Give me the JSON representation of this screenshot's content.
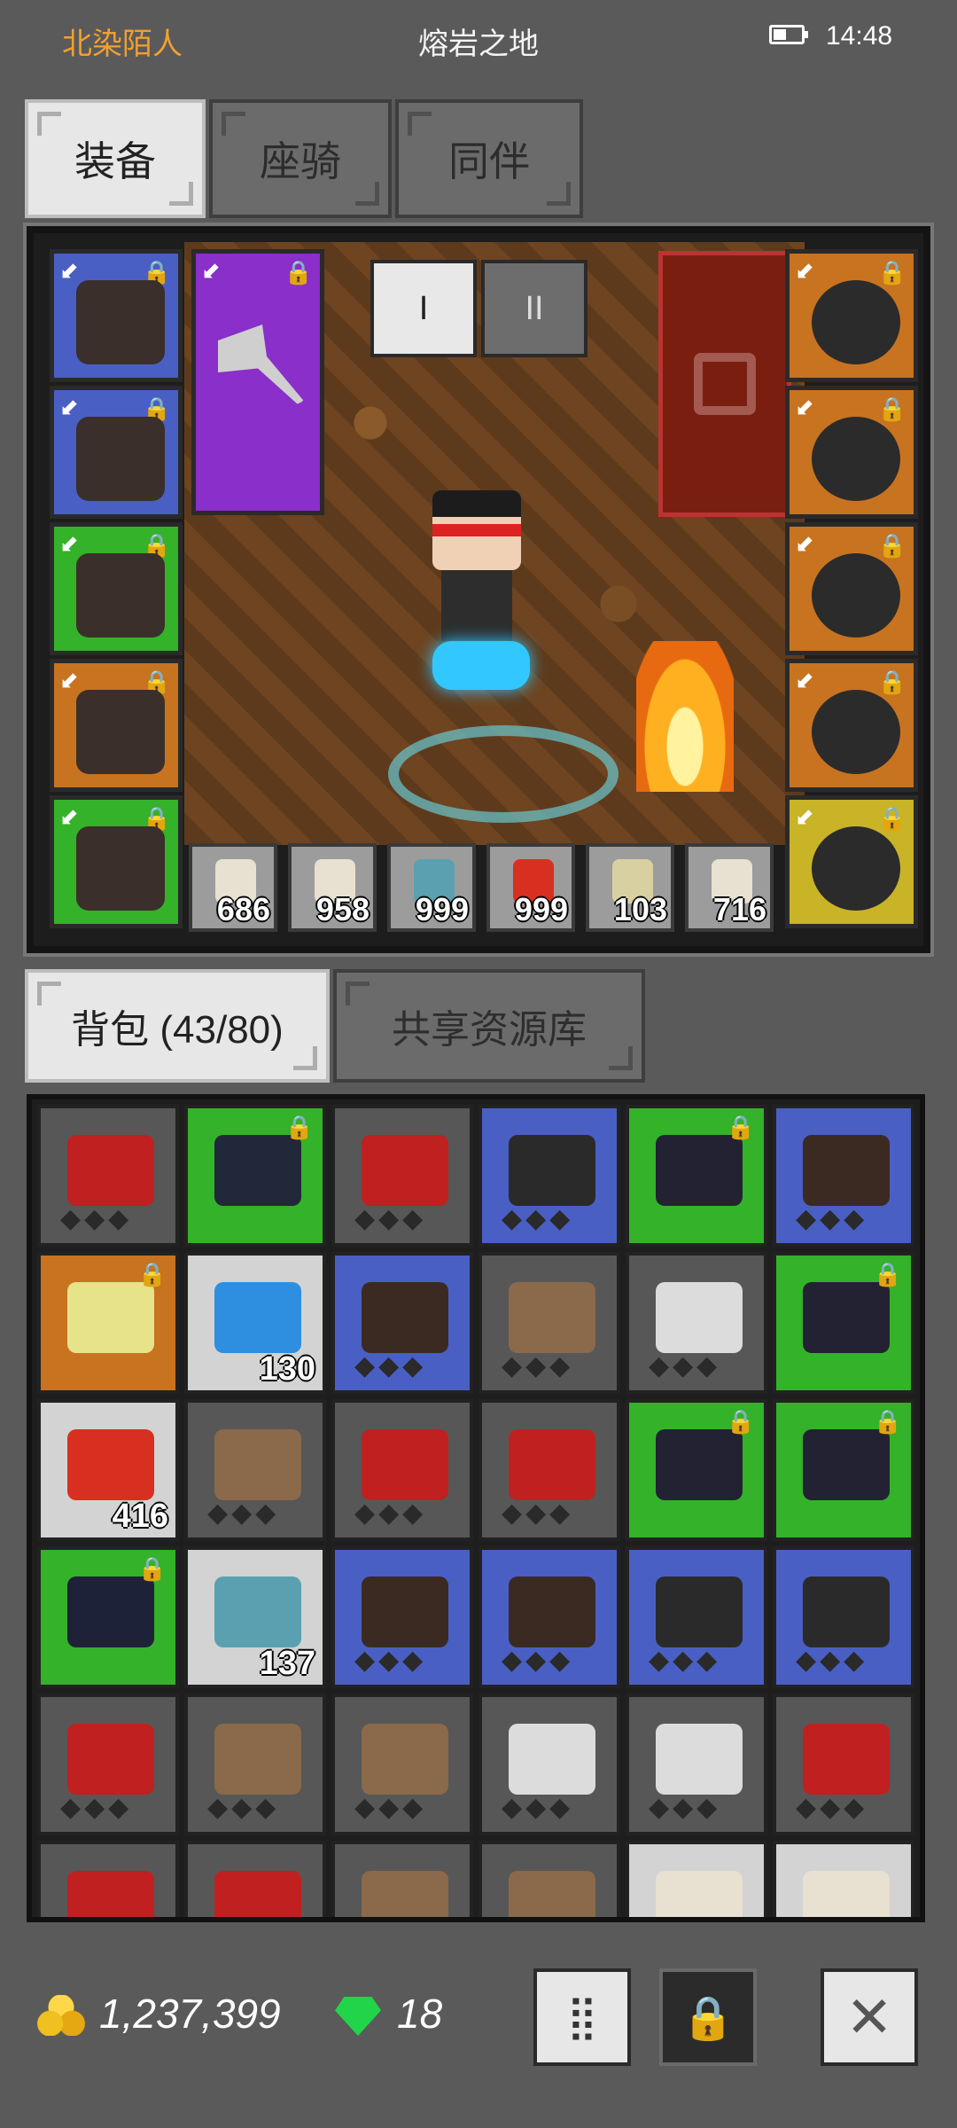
{
  "status": {
    "player": "北染陌人",
    "map": "熔岩之地",
    "time": "14:48"
  },
  "top_tabs": [
    "装备",
    "座骑",
    "同伴"
  ],
  "equip": {
    "set_buttons": [
      "I",
      "II"
    ],
    "potions": [
      {
        "qty": "686",
        "color": "#e8e0d0"
      },
      {
        "qty": "958",
        "color": "#e8e0d0"
      },
      {
        "qty": "999",
        "color": "#5aa0b0"
      },
      {
        "qty": "999",
        "color": "#d83020"
      },
      {
        "qty": "103",
        "color": "#d8d0a0"
      },
      {
        "qty": "716",
        "color": "#e8e0d0"
      }
    ],
    "left_slots": [
      {
        "color": "blue",
        "icon": "helmet-icon"
      },
      {
        "color": "blue",
        "icon": "chest-armor-icon"
      },
      {
        "color": "green",
        "icon": "gauntlet-icon"
      },
      {
        "color": "orange",
        "icon": "boots-icon"
      },
      {
        "color": "green",
        "icon": "pauldron-icon"
      }
    ],
    "right_slots": [
      {
        "color": "orange",
        "icon": "ruby-amulet-icon"
      },
      {
        "color": "orange",
        "icon": "emerald-ring-icon"
      },
      {
        "color": "orange",
        "icon": "emerald-ring-icon"
      },
      {
        "color": "orange",
        "icon": "blue-orb-icon"
      },
      {
        "color": "yellow",
        "icon": "cat-pet-icon"
      }
    ]
  },
  "bag_tabs": [
    "背包 (43/80)",
    "共享资源库"
  ],
  "bag": [
    {
      "c": "",
      "ico": "red-bow-icon",
      "col": "#c02020",
      "lock": false,
      "gem": true
    },
    {
      "c": "green",
      "ico": "helmet-icon",
      "col": "#20283a",
      "lock": true,
      "gem": false
    },
    {
      "c": "",
      "ico": "red-bow-icon",
      "col": "#c02020",
      "lock": false,
      "gem": true
    },
    {
      "c": "blue",
      "ico": "chest-armor-icon",
      "col": "#2a2a2a",
      "lock": false,
      "gem": true
    },
    {
      "c": "green",
      "ico": "mace-icon",
      "col": "#222233",
      "lock": true,
      "gem": false
    },
    {
      "c": "blue",
      "ico": "helmet-icon",
      "col": "#3a2a22",
      "lock": false,
      "gem": true
    },
    {
      "c": "orange",
      "ico": "shield-egg-icon",
      "col": "#e6e38a",
      "lock": true,
      "gem": false
    },
    {
      "c": "white",
      "ico": "blue-feather-icon",
      "col": "#2e8fe0",
      "lock": false,
      "gem": false,
      "qty": "130"
    },
    {
      "c": "blue",
      "ico": "helmet-icon",
      "col": "#3a2a22",
      "lock": false,
      "gem": true
    },
    {
      "c": "",
      "ico": "wood-bow-icon",
      "col": "#8a6a4a",
      "lock": false,
      "gem": true
    },
    {
      "c": "",
      "ico": "axe-icon",
      "col": "#dcdcdc",
      "lock": false,
      "gem": true
    },
    {
      "c": "green",
      "ico": "mace-icon",
      "col": "#222233",
      "lock": true,
      "gem": false
    },
    {
      "c": "white",
      "ico": "red-feather-icon",
      "col": "#d83020",
      "lock": false,
      "gem": false,
      "qty": "416"
    },
    {
      "c": "",
      "ico": "wood-bow-icon",
      "col": "#8a6a4a",
      "lock": false,
      "gem": true
    },
    {
      "c": "",
      "ico": "red-spear-icon",
      "col": "#c02020",
      "lock": false,
      "gem": true
    },
    {
      "c": "",
      "ico": "red-bow-icon",
      "col": "#c02020",
      "lock": false,
      "gem": true
    },
    {
      "c": "green",
      "ico": "mace-icon",
      "col": "#222233",
      "lock": true,
      "gem": false
    },
    {
      "c": "green",
      "ico": "mace-icon",
      "col": "#222233",
      "lock": true,
      "gem": false
    },
    {
      "c": "green",
      "ico": "chest-armor-icon",
      "col": "#1e2238",
      "lock": true,
      "gem": false
    },
    {
      "c": "white",
      "ico": "fish-icon",
      "col": "#5aa0b0",
      "lock": false,
      "gem": false,
      "qty": "137"
    },
    {
      "c": "blue",
      "ico": "helmet-icon",
      "col": "#3a2a22",
      "lock": false,
      "gem": true
    },
    {
      "c": "blue",
      "ico": "helmet-icon",
      "col": "#3a2a22",
      "lock": false,
      "gem": true
    },
    {
      "c": "blue",
      "ico": "chest-armor-icon",
      "col": "#2a2a2a",
      "lock": false,
      "gem": true
    },
    {
      "c": "blue",
      "ico": "chest-armor-icon",
      "col": "#2a2a2a",
      "lock": false,
      "gem": true
    },
    {
      "c": "",
      "ico": "red-bow-icon",
      "col": "#c02020",
      "lock": false,
      "gem": true
    },
    {
      "c": "",
      "ico": "wood-bow-icon",
      "col": "#8a6a4a",
      "lock": false,
      "gem": true
    },
    {
      "c": "",
      "ico": "wood-bow-icon",
      "col": "#8a6a4a",
      "lock": false,
      "gem": true
    },
    {
      "c": "",
      "ico": "axe-icon",
      "col": "#dcdcdc",
      "lock": false,
      "gem": true
    },
    {
      "c": "",
      "ico": "axe-icon",
      "col": "#dcdcdc",
      "lock": false,
      "gem": true
    },
    {
      "c": "",
      "ico": "red-spear-icon",
      "col": "#c02020",
      "lock": false,
      "gem": true
    },
    {
      "c": "",
      "ico": "red-bow-icon",
      "col": "#c02020",
      "lock": false,
      "gem": false
    },
    {
      "c": "",
      "ico": "red-bow-icon",
      "col": "#c02020",
      "lock": false,
      "gem": false
    },
    {
      "c": "",
      "ico": "wood-bow-icon",
      "col": "#8a6a4a",
      "lock": false,
      "gem": false
    },
    {
      "c": "",
      "ico": "wood-bow-icon",
      "col": "#8a6a4a",
      "lock": false,
      "gem": false
    },
    {
      "c": "white",
      "ico": "potion-icon",
      "col": "#e8e0d0",
      "lock": false,
      "gem": false
    },
    {
      "c": "white",
      "ico": "potion-icon",
      "col": "#e8e0d0",
      "lock": false,
      "gem": false
    }
  ],
  "currency": {
    "gold": "1,237,399",
    "gems": "18"
  },
  "bottom_buttons": {
    "sort": "⣿",
    "lock": "🔒",
    "close": "✕"
  }
}
